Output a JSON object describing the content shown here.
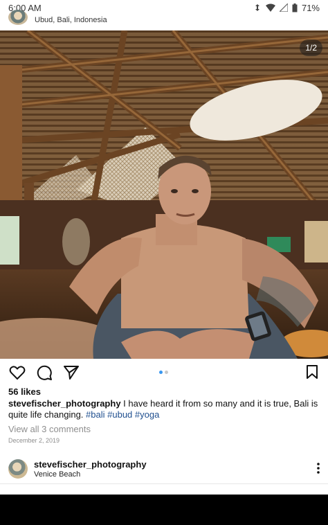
{
  "status_bar": {
    "time": "6:00 AM",
    "battery": "71%",
    "icons": [
      "sync-icon",
      "wifi-icon",
      "signal-icon",
      "battery-icon"
    ]
  },
  "post": {
    "location": "Ubud, Bali, Indonesia",
    "photo_counter": "1/2",
    "carousel": {
      "count": 2,
      "active": 1
    },
    "action_icons": [
      "heart-icon",
      "comment-icon",
      "share-icon",
      "bookmark-icon"
    ],
    "likes": "56 likes",
    "caption": {
      "username": "stevefischer_photography",
      "text_1": " I have heard it from so many and it is true, Bali is quite life changing. ",
      "tag_1": "#bali",
      "sep_1": " ",
      "tag_2": "#ubud",
      "sep_2": " ",
      "tag_3": "#yoga"
    },
    "comments_link": "View all 3 comments",
    "date": "December 2, 2019"
  },
  "next_post": {
    "username": "stevefischer_photography",
    "location": "Venice Beach"
  },
  "colors": {
    "link_blue": "#1f4f8f",
    "active_dot": "#3897f0",
    "muted_text": "#8e8e8e"
  }
}
